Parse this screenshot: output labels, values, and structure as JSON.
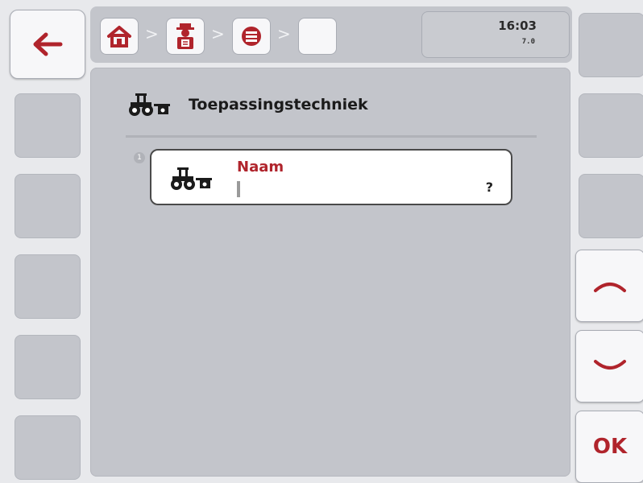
{
  "status": {
    "time": "16:03",
    "version": "7.0"
  },
  "breadcrumb": {
    "items": [
      {
        "icon": "home-icon"
      },
      {
        "icon": "operator-terminal-icon"
      },
      {
        "icon": "list-icon"
      },
      {
        "icon": "empty"
      }
    ],
    "separator": ">"
  },
  "page": {
    "title": "Toepassingstechniek",
    "icon": "tractor-icon"
  },
  "fields": [
    {
      "index": "1",
      "label": "Naam",
      "value": "",
      "hint": "?"
    }
  ],
  "softkeys": {
    "ok_label": "OK"
  },
  "colors": {
    "accent": "#b0242c",
    "panel": "#c3c5cb",
    "button": "#f7f7f9"
  }
}
